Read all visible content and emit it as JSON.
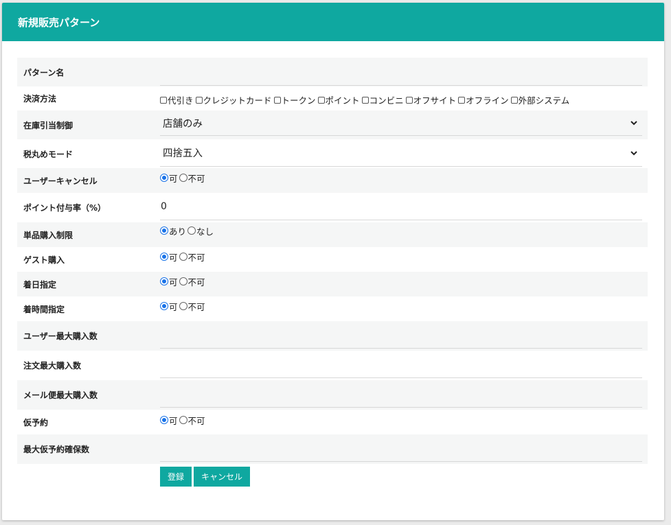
{
  "header": {
    "title": "新規販売パターン"
  },
  "fields": {
    "pattern_name": {
      "label": "パターン名",
      "value": ""
    },
    "payment": {
      "label": "決済方法",
      "options": [
        "代引き",
        "クレジットカード",
        "トークン",
        "ポイント",
        "コンビニ",
        "オフサイト",
        "オフライン",
        "外部システム"
      ]
    },
    "stock": {
      "label": "在庫引当制御",
      "value": "店舗のみ"
    },
    "tax": {
      "label": "税丸めモード",
      "value": "四捨五入"
    },
    "user_cancel": {
      "label": "ユーザーキャンセル",
      "options": [
        "可",
        "不可"
      ]
    },
    "point_rate": {
      "label": "ポイント付与率（%）",
      "value": "0"
    },
    "single_limit": {
      "label": "単品購入制限",
      "options": [
        "あり",
        "なし"
      ]
    },
    "guest": {
      "label": "ゲスト購入",
      "options": [
        "可",
        "不可"
      ]
    },
    "arrival_date": {
      "label": "着日指定",
      "options": [
        "可",
        "不可"
      ]
    },
    "arrival_time": {
      "label": "着時間指定",
      "options": [
        "可",
        "不可"
      ]
    },
    "user_max": {
      "label": "ユーザー最大購入数",
      "value": ""
    },
    "order_max": {
      "label": "注文最大購入数",
      "value": ""
    },
    "mail_max": {
      "label": "メール便最大購入数",
      "value": ""
    },
    "reservation": {
      "label": "仮予約",
      "options": [
        "可",
        "不可"
      ]
    },
    "max_reservation": {
      "label": "最大仮予約確保数",
      "value": ""
    }
  },
  "buttons": {
    "register": "登録",
    "cancel": "キャンセル"
  },
  "colors": {
    "accent": "#0fa8a0",
    "radio": "#1a73e8"
  }
}
